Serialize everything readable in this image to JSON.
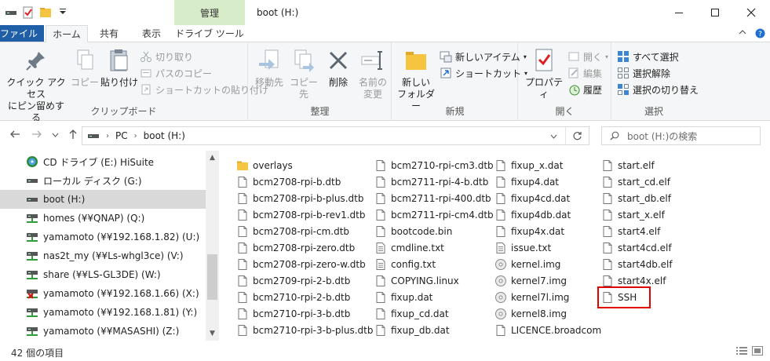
{
  "window": {
    "title": "boot (H:)",
    "contextual_tab": "管理"
  },
  "tabs": [
    {
      "label": "ファイル"
    },
    {
      "label": "ホーム"
    },
    {
      "label": "共有"
    },
    {
      "label": "表示"
    },
    {
      "label": "ドライブ ツール"
    }
  ],
  "ribbon": {
    "clipboard": {
      "label": "クリップボード",
      "pin_line1": "クイック アクセス",
      "pin_line2": "にピン留めする",
      "copy": "コピー",
      "paste": "貼り付け",
      "cut": "切り取り",
      "copy_path": "パスのコピー",
      "paste_shortcut": "ショートカットの貼り付け"
    },
    "organize": {
      "label": "整理",
      "move_to": "移動先",
      "copy_to": "コピー先",
      "delete": "削除",
      "rename_line1": "名前の",
      "rename_line2": "変更"
    },
    "new": {
      "label": "新規",
      "new_folder_line1": "新しい",
      "new_folder_line2": "フォルダー",
      "new_item": "新しいアイテム",
      "shortcut": "ショートカット"
    },
    "open": {
      "label": "開く",
      "properties": "プロパティ",
      "open": "開く",
      "edit": "編集",
      "history": "履歴"
    },
    "select": {
      "label": "選択",
      "select_all": "すべて選択",
      "select_none": "選択解除",
      "invert": "選択の切り替え"
    }
  },
  "address": {
    "crumbs": [
      "PC",
      "boot (H:)"
    ],
    "search_placeholder": "boot (H:)の検索"
  },
  "nav": [
    {
      "label": "CD ドライブ (E:) HiSuite",
      "icon": "cd-drive-icon",
      "selected": false
    },
    {
      "label": "ローカル ディスク (G:)",
      "icon": "drive-icon",
      "selected": false
    },
    {
      "label": "boot (H:)",
      "icon": "drive-icon",
      "selected": true
    },
    {
      "label": "homes (¥¥QNAP) (Q:)",
      "icon": "network-drive-icon",
      "selected": false
    },
    {
      "label": "yamamoto (¥¥192.168.1.82) (U:)",
      "icon": "network-drive-icon",
      "selected": false
    },
    {
      "label": "nas2t_my (¥¥Ls-whgl3ce) (V:)",
      "icon": "network-drive-icon",
      "selected": false
    },
    {
      "label": "share (¥¥LS-GL3DE) (W:)",
      "icon": "network-drive-icon",
      "selected": false
    },
    {
      "label": "yamamoto (¥¥192.168.1.66) (X:)",
      "icon": "disconnected-drive-icon",
      "selected": false
    },
    {
      "label": "yamamoto (¥¥192.168.1.81) (Y:)",
      "icon": "network-drive-icon",
      "selected": false
    },
    {
      "label": "yamamoto (¥¥MASASHI) (Z:)",
      "icon": "network-drive-icon",
      "selected": false
    }
  ],
  "files": [
    [
      {
        "name": "overlays",
        "type": "folder"
      },
      {
        "name": "bcm2708-rpi-b.dtb",
        "type": "file"
      },
      {
        "name": "bcm2708-rpi-b-plus.dtb",
        "type": "file"
      },
      {
        "name": "bcm2708-rpi-b-rev1.dtb",
        "type": "file"
      },
      {
        "name": "bcm2708-rpi-cm.dtb",
        "type": "file"
      },
      {
        "name": "bcm2708-rpi-zero.dtb",
        "type": "file"
      },
      {
        "name": "bcm2708-rpi-zero-w.dtb",
        "type": "file"
      },
      {
        "name": "bcm2709-rpi-2-b.dtb",
        "type": "file"
      },
      {
        "name": "bcm2710-rpi-2-b.dtb",
        "type": "file"
      },
      {
        "name": "bcm2710-rpi-3-b.dtb",
        "type": "file"
      },
      {
        "name": "bcm2710-rpi-3-b-plus.dtb",
        "type": "file"
      }
    ],
    [
      {
        "name": "bcm2710-rpi-cm3.dtb",
        "type": "file"
      },
      {
        "name": "bcm2711-rpi-4-b.dtb",
        "type": "file"
      },
      {
        "name": "bcm2711-rpi-400.dtb",
        "type": "file"
      },
      {
        "name": "bcm2711-rpi-cm4.dtb",
        "type": "file"
      },
      {
        "name": "bootcode.bin",
        "type": "file"
      },
      {
        "name": "cmdline.txt",
        "type": "text"
      },
      {
        "name": "config.txt",
        "type": "text"
      },
      {
        "name": "COPYING.linux",
        "type": "file"
      },
      {
        "name": "fixup.dat",
        "type": "file"
      },
      {
        "name": "fixup_cd.dat",
        "type": "file"
      },
      {
        "name": "fixup_db.dat",
        "type": "file"
      }
    ],
    [
      {
        "name": "fixup_x.dat",
        "type": "file"
      },
      {
        "name": "fixup4.dat",
        "type": "file"
      },
      {
        "name": "fixup4cd.dat",
        "type": "file"
      },
      {
        "name": "fixup4db.dat",
        "type": "file"
      },
      {
        "name": "fixup4x.dat",
        "type": "file"
      },
      {
        "name": "issue.txt",
        "type": "text"
      },
      {
        "name": "kernel.img",
        "type": "disc"
      },
      {
        "name": "kernel7.img",
        "type": "disc"
      },
      {
        "name": "kernel7l.img",
        "type": "disc"
      },
      {
        "name": "kernel8.img",
        "type": "disc"
      },
      {
        "name": "LICENCE.broadcom",
        "type": "file"
      }
    ],
    [
      {
        "name": "start.elf",
        "type": "file"
      },
      {
        "name": "start_cd.elf",
        "type": "file"
      },
      {
        "name": "start_db.elf",
        "type": "file"
      },
      {
        "name": "start_x.elf",
        "type": "file"
      },
      {
        "name": "start4.elf",
        "type": "file"
      },
      {
        "name": "start4cd.elf",
        "type": "file"
      },
      {
        "name": "start4db.elf",
        "type": "file"
      },
      {
        "name": "start4x.elf",
        "type": "file"
      },
      {
        "name": "SSH",
        "type": "file",
        "highlighted": true
      }
    ]
  ],
  "status": {
    "count": "42 個の項目"
  },
  "colors": {
    "file_tab": "#1f5fa8",
    "context_tab": "#d7ecc8",
    "highlight": "#e00000",
    "folder": "#f5c542"
  }
}
